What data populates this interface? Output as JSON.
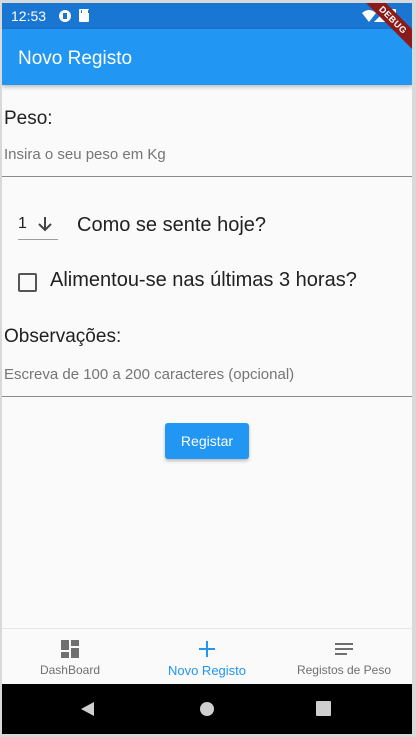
{
  "status_bar": {
    "time": "12:53"
  },
  "app_bar": {
    "title": "Novo Registo",
    "debug_banner": "DEBUG"
  },
  "form": {
    "weight_label": "Peso:",
    "weight_placeholder": "Insira o seu peso em Kg",
    "mood_value": "1",
    "mood_label": "Como se sente hoje?",
    "ate_label": "Alimentou-se nas últimas 3 horas?",
    "ate_checked": false,
    "notes_label": "Observações:",
    "notes_placeholder": "Escreva de 100 a 200 caracteres (opcional)",
    "submit_label": "Registar"
  },
  "bottom_nav": {
    "items": [
      {
        "label": "DashBoard",
        "icon": "dashboard-icon"
      },
      {
        "label": "Novo Registo",
        "icon": "add-icon",
        "active": true
      },
      {
        "label": "Registos de Peso",
        "icon": "list-icon"
      }
    ]
  },
  "colors": {
    "primary": "#2196f3",
    "status_bar": "#1976d2",
    "debug": "#8b1a1a"
  }
}
